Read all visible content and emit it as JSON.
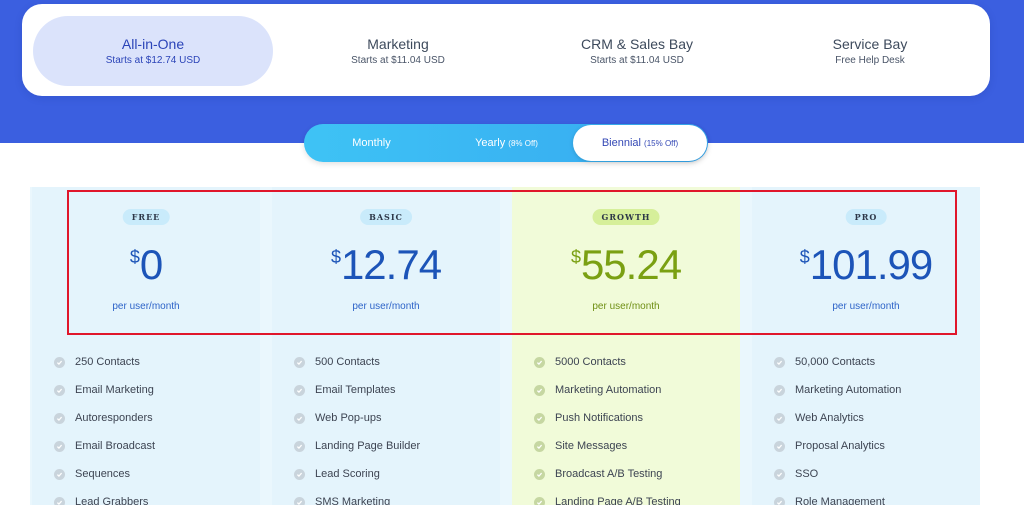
{
  "products": [
    {
      "name": "All-in-One",
      "sub": "Starts at $12.74 USD",
      "active": true
    },
    {
      "name": "Marketing",
      "sub": "Starts at $11.04 USD",
      "active": false
    },
    {
      "name": "CRM & Sales Bay",
      "sub": "Starts at $11.04 USD",
      "active": false
    },
    {
      "name": "Service Bay",
      "sub": "Free Help Desk",
      "active": false
    }
  ],
  "billing": [
    {
      "label": "Monthly",
      "discount": "",
      "active": false
    },
    {
      "label": "Yearly",
      "discount": "(8% Off)",
      "active": false
    },
    {
      "label": "Biennial",
      "discount": "(15% Off)",
      "active": true
    }
  ],
  "plans": [
    {
      "badge": "FREE",
      "currency": "$",
      "price": "0",
      "per": "per user/month",
      "features": [
        "250 Contacts",
        "Email Marketing",
        "Autoresponders",
        "Email Broadcast",
        "Sequences",
        "Lead Grabbers"
      ]
    },
    {
      "badge": "BASIC",
      "currency": "$",
      "price": "12.74",
      "per": "per user/month",
      "features": [
        "500 Contacts",
        "Email Templates",
        "Web Pop-ups",
        "Landing Page Builder",
        "Lead Scoring",
        "SMS Marketing"
      ]
    },
    {
      "badge": "GROWTH",
      "currency": "$",
      "price": "55.24",
      "per": "per user/month",
      "features": [
        "5000 Contacts",
        "Marketing Automation",
        "Push Notifications",
        "Site Messages",
        "Broadcast A/B Testing",
        "Landing Page A/B Testing"
      ]
    },
    {
      "badge": "PRO",
      "currency": "$",
      "price": "101.99",
      "per": "per user/month",
      "features": [
        "50,000 Contacts",
        "Marketing Automation",
        "Web Analytics",
        "Proposal Analytics",
        "SSO",
        "Role Management"
      ]
    }
  ],
  "colors": {
    "hero": "#3b5fe0",
    "toggle": "#3ec3f5",
    "highlight": "#e0162b",
    "growth_price": "#7aa012",
    "plan_price": "#1c54b8"
  },
  "icons": {
    "feature": "check-circle-icon"
  }
}
